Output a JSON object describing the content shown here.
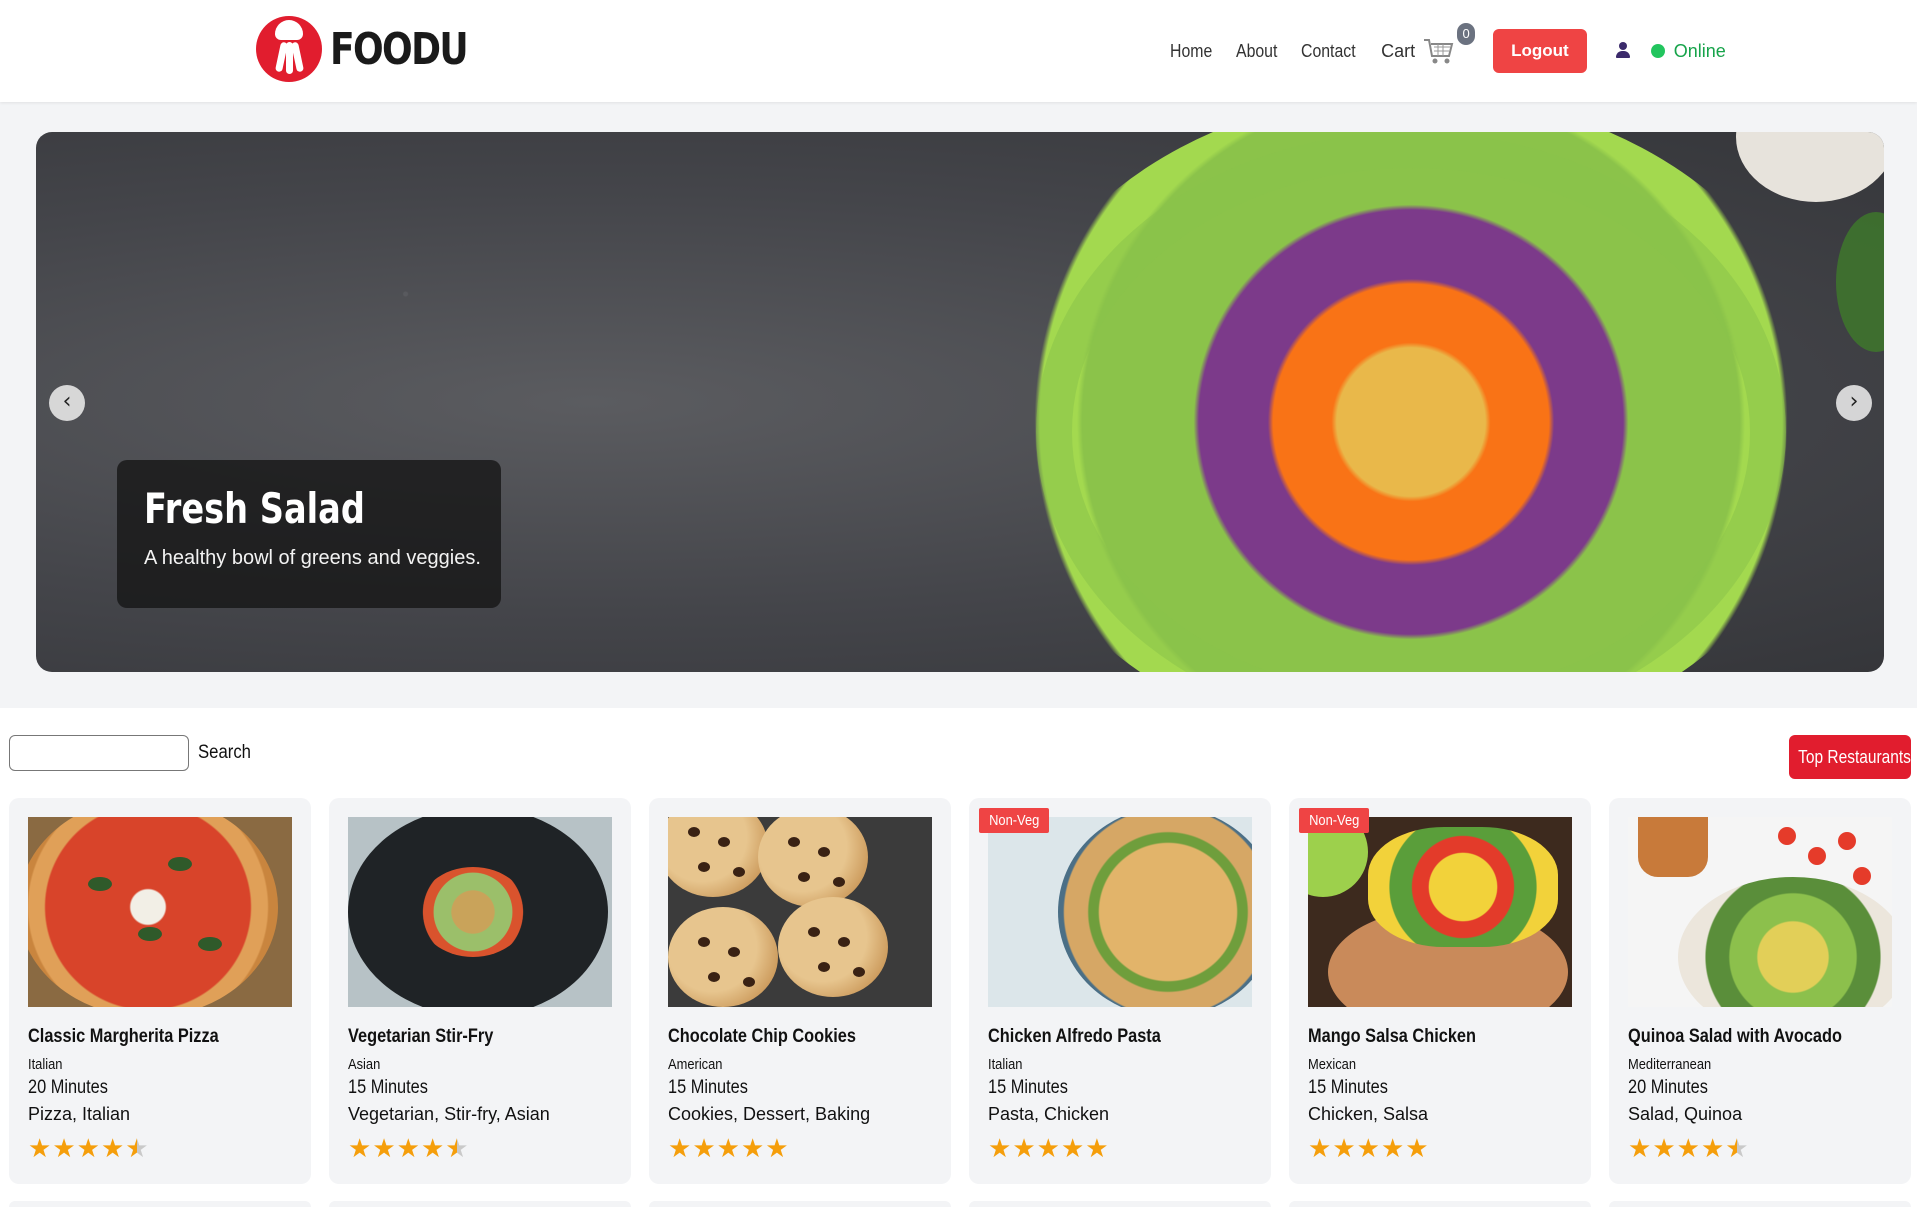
{
  "header": {
    "logo_text": "FOODU",
    "nav": [
      "Home",
      "About",
      "Contact"
    ],
    "cart_label": "Cart",
    "cart_count": "0",
    "logout_label": "Logout",
    "status_label": "Online"
  },
  "hero": {
    "title": "Fresh Salad",
    "subtitle": "A healthy bowl of greens and veggies.",
    "prev_icon": "‹",
    "next_icon": "›"
  },
  "toolbar": {
    "search_placeholder": "",
    "search_label": "Search",
    "top_restaurants_label": "Top Restaurants"
  },
  "cards": [
    {
      "title": "Classic Margherita Pizza",
      "cuisine": "Italian",
      "time": "20 Minutes",
      "tags": "Pizza, Italian",
      "rating": 4.5,
      "badge": ""
    },
    {
      "title": "Vegetarian Stir-Fry",
      "cuisine": "Asian",
      "time": "15 Minutes",
      "tags": "Vegetarian, Stir-fry, Asian",
      "rating": 4.5,
      "badge": ""
    },
    {
      "title": "Chocolate Chip Cookies",
      "cuisine": "American",
      "time": "15 Minutes",
      "tags": "Cookies, Dessert, Baking",
      "rating": 5,
      "badge": ""
    },
    {
      "title": "Chicken Alfredo Pasta",
      "cuisine": "Italian",
      "time": "15 Minutes",
      "tags": "Pasta, Chicken",
      "rating": 5,
      "badge": "Non-Veg"
    },
    {
      "title": "Mango Salsa Chicken",
      "cuisine": "Mexican",
      "time": "15 Minutes",
      "tags": "Chicken, Salsa",
      "rating": 5,
      "badge": "Non-Veg"
    },
    {
      "title": "Quinoa Salad with Avocado",
      "cuisine": "Mediterranean",
      "time": "20 Minutes",
      "tags": "Salad, Quinoa",
      "rating": 4.5,
      "badge": ""
    }
  ],
  "colors": {
    "brand_red": "#e11d2e",
    "logout_red": "#ef4444",
    "online_green": "#22c55e",
    "star_gold": "#f59e0b"
  }
}
